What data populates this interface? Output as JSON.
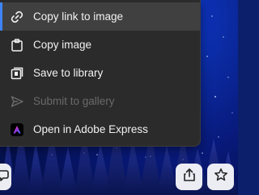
{
  "menu": {
    "items": [
      {
        "label": "Copy link to image",
        "icon": "link-icon",
        "state": "highlighted"
      },
      {
        "label": "Copy image",
        "icon": "clipboard-icon",
        "state": "enabled"
      },
      {
        "label": "Save to library",
        "icon": "library-icon",
        "state": "enabled"
      },
      {
        "label": "Submit to gallery",
        "icon": "send-icon",
        "state": "disabled"
      },
      {
        "label": "Open in Adobe Express",
        "icon": "adobe-express-icon",
        "state": "enabled"
      }
    ]
  },
  "toolbar": {
    "left_icon": "chat-icon",
    "share_icon": "share-icon",
    "favorite_icon": "star-icon"
  },
  "colors": {
    "menu_bg": "#2b2b2b",
    "highlight_bg": "#404040",
    "accent": "#3e84f6",
    "text": "#f2f2f2",
    "disabled_text": "#6a6a6a"
  }
}
